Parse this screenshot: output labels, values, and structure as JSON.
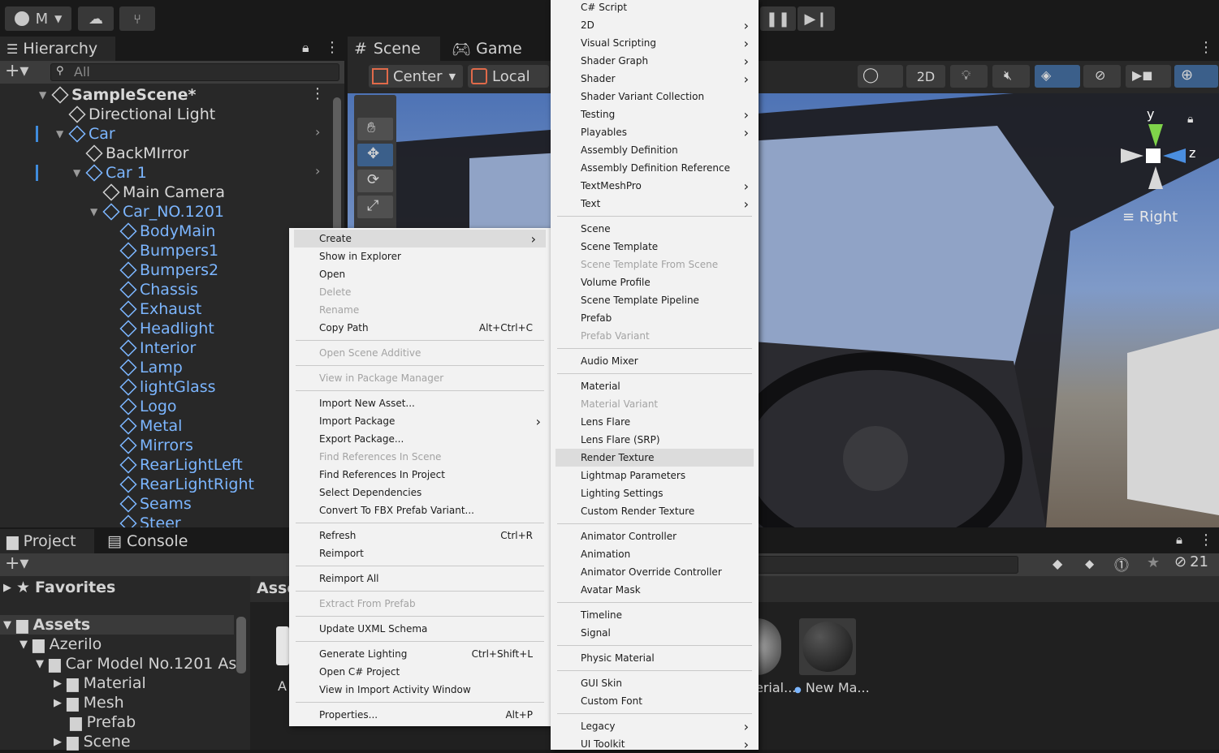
{
  "toolbar": {
    "account": "M"
  },
  "hierarchy": {
    "tab": "Hierarchy",
    "search_placeholder": "All",
    "items": [
      {
        "label": "SampleScene*",
        "cls": "white",
        "indent": 0,
        "bold": true
      },
      {
        "label": "Directional Light",
        "cls": "white",
        "indent": 1
      },
      {
        "label": "Car",
        "cls": "blue",
        "indent": 1
      },
      {
        "label": "BackMIrror",
        "cls": "white",
        "indent": 2
      },
      {
        "label": "Car 1",
        "cls": "blue",
        "indent": 2
      },
      {
        "label": "Main Camera",
        "cls": "white",
        "indent": 3
      },
      {
        "label": "Car_NO.1201",
        "cls": "blue",
        "indent": 3
      },
      {
        "label": "BodyMain",
        "cls": "blue",
        "indent": 4
      },
      {
        "label": "Bumpers1",
        "cls": "blue",
        "indent": 4
      },
      {
        "label": "Bumpers2",
        "cls": "blue",
        "indent": 4
      },
      {
        "label": "Chassis",
        "cls": "blue",
        "indent": 4
      },
      {
        "label": "Exhaust",
        "cls": "blue",
        "indent": 4
      },
      {
        "label": "Headlight",
        "cls": "blue",
        "indent": 4
      },
      {
        "label": "Interior",
        "cls": "blue",
        "indent": 4
      },
      {
        "label": "Lamp",
        "cls": "blue",
        "indent": 4
      },
      {
        "label": "lightGlass",
        "cls": "blue",
        "indent": 4
      },
      {
        "label": "Logo",
        "cls": "blue",
        "indent": 4
      },
      {
        "label": "Metal",
        "cls": "blue",
        "indent": 4
      },
      {
        "label": "Mirrors",
        "cls": "blue",
        "indent": 4
      },
      {
        "label": "RearLightLeft",
        "cls": "blue",
        "indent": 4
      },
      {
        "label": "RearLightRight",
        "cls": "blue",
        "indent": 4
      },
      {
        "label": "Seams",
        "cls": "blue",
        "indent": 4
      },
      {
        "label": "Steer",
        "cls": "blue",
        "indent": 4
      }
    ]
  },
  "scene": {
    "tab_scene": "Scene",
    "tab_game": "Game",
    "pivot": "Center",
    "space": "Local",
    "btn_2d": "2D",
    "gizmo_y": "y",
    "gizmo_z": "z",
    "view_label": "Right"
  },
  "project": {
    "tab_project": "Project",
    "tab_console": "Console",
    "favorites": "Favorites",
    "assets": "Assets",
    "azerilo": "Azerilo",
    "car_model": "Car Model No.1201 As",
    "material": "Material",
    "mesh": "Mesh",
    "prefab": "Prefab",
    "scene": "Scene",
    "breadcrumb": "Asse",
    "hidden_count": "21",
    "asset_a": "A",
    "asset_erial": "erial...",
    "asset_newma": "New Ma..."
  },
  "context_menu": [
    {
      "label": "Create",
      "arrow": true,
      "hl": true
    },
    {
      "label": "Show in Explorer"
    },
    {
      "label": "Open"
    },
    {
      "label": "Delete",
      "dis": true
    },
    {
      "label": "Rename",
      "dis": true
    },
    {
      "label": "Copy Path",
      "sc": "Alt+Ctrl+C"
    },
    {
      "sep": true
    },
    {
      "label": "Open Scene Additive",
      "dis": true
    },
    {
      "sep": true
    },
    {
      "label": "View in Package Manager",
      "dis": true
    },
    {
      "sep": true
    },
    {
      "label": "Import New Asset..."
    },
    {
      "label": "Import Package",
      "arrow": true
    },
    {
      "label": "Export Package..."
    },
    {
      "label": "Find References In Scene",
      "dis": true
    },
    {
      "label": "Find References In Project"
    },
    {
      "label": "Select Dependencies"
    },
    {
      "label": "Convert To FBX Prefab Variant..."
    },
    {
      "sep": true
    },
    {
      "label": "Refresh",
      "sc": "Ctrl+R"
    },
    {
      "label": "Reimport"
    },
    {
      "sep": true
    },
    {
      "label": "Reimport All"
    },
    {
      "sep": true
    },
    {
      "label": "Extract From Prefab",
      "dis": true
    },
    {
      "sep": true
    },
    {
      "label": "Update UXML Schema"
    },
    {
      "sep": true
    },
    {
      "label": "Generate Lighting",
      "sc": "Ctrl+Shift+L"
    },
    {
      "label": "Open C# Project"
    },
    {
      "label": "View in Import Activity Window"
    },
    {
      "sep": true
    },
    {
      "label": "Properties...",
      "sc": "Alt+P"
    }
  ],
  "create_menu": [
    {
      "label": "C# Script"
    },
    {
      "label": "2D",
      "arrow": true
    },
    {
      "label": "Visual Scripting",
      "arrow": true
    },
    {
      "label": "Shader Graph",
      "arrow": true
    },
    {
      "label": "Shader",
      "arrow": true
    },
    {
      "label": "Shader Variant Collection"
    },
    {
      "label": "Testing",
      "arrow": true
    },
    {
      "label": "Playables",
      "arrow": true
    },
    {
      "label": "Assembly Definition"
    },
    {
      "label": "Assembly Definition Reference"
    },
    {
      "label": "TextMeshPro",
      "arrow": true
    },
    {
      "label": "Text",
      "arrow": true
    },
    {
      "sep": true
    },
    {
      "label": "Scene"
    },
    {
      "label": "Scene Template"
    },
    {
      "label": "Scene Template From Scene",
      "dis": true
    },
    {
      "label": "Volume Profile"
    },
    {
      "label": "Scene Template Pipeline"
    },
    {
      "label": "Prefab"
    },
    {
      "label": "Prefab Variant",
      "dis": true
    },
    {
      "sep": true
    },
    {
      "label": "Audio Mixer"
    },
    {
      "sep": true
    },
    {
      "label": "Material"
    },
    {
      "label": "Material Variant",
      "dis": true
    },
    {
      "label": "Lens Flare"
    },
    {
      "label": "Lens Flare (SRP)"
    },
    {
      "label": "Render Texture",
      "hl": true
    },
    {
      "label": "Lightmap Parameters"
    },
    {
      "label": "Lighting Settings"
    },
    {
      "label": "Custom Render Texture"
    },
    {
      "sep": true
    },
    {
      "label": "Animator Controller"
    },
    {
      "label": "Animation"
    },
    {
      "label": "Animator Override Controller"
    },
    {
      "label": "Avatar Mask"
    },
    {
      "sep": true
    },
    {
      "label": "Timeline"
    },
    {
      "label": "Signal"
    },
    {
      "sep": true
    },
    {
      "label": "Physic Material"
    },
    {
      "sep": true
    },
    {
      "label": "GUI Skin"
    },
    {
      "label": "Custom Font"
    },
    {
      "sep": true
    },
    {
      "label": "Legacy",
      "arrow": true
    },
    {
      "label": "UI Toolkit",
      "arrow": true
    }
  ]
}
